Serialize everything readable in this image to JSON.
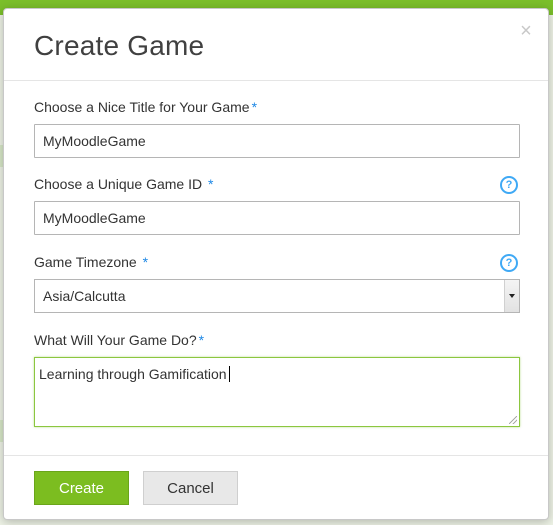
{
  "dialog": {
    "title": "Create Game",
    "close_symbol": "×"
  },
  "fields": {
    "title": {
      "label": "Choose a Nice Title for Your Game",
      "required_mark": "*",
      "value": "MyMoodleGame"
    },
    "game_id": {
      "label": "Choose a Unique Game ID",
      "required_mark": "*",
      "value": "MyMoodleGame",
      "help_icon": "question-circle-icon",
      "help_symbol": "?"
    },
    "timezone": {
      "label": "Game Timezone",
      "required_mark": "*",
      "selected": "Asia/Calcutta",
      "help_icon": "question-circle-icon",
      "help_symbol": "?"
    },
    "description": {
      "label": "What Will Your Game Do?",
      "required_mark": "*",
      "value": "Learning through Gamification"
    }
  },
  "footer": {
    "create_label": "Create",
    "cancel_label": "Cancel"
  },
  "colors": {
    "accent": "#7cbd20",
    "help": "#3fa9f5",
    "required": "#1e88e5"
  }
}
